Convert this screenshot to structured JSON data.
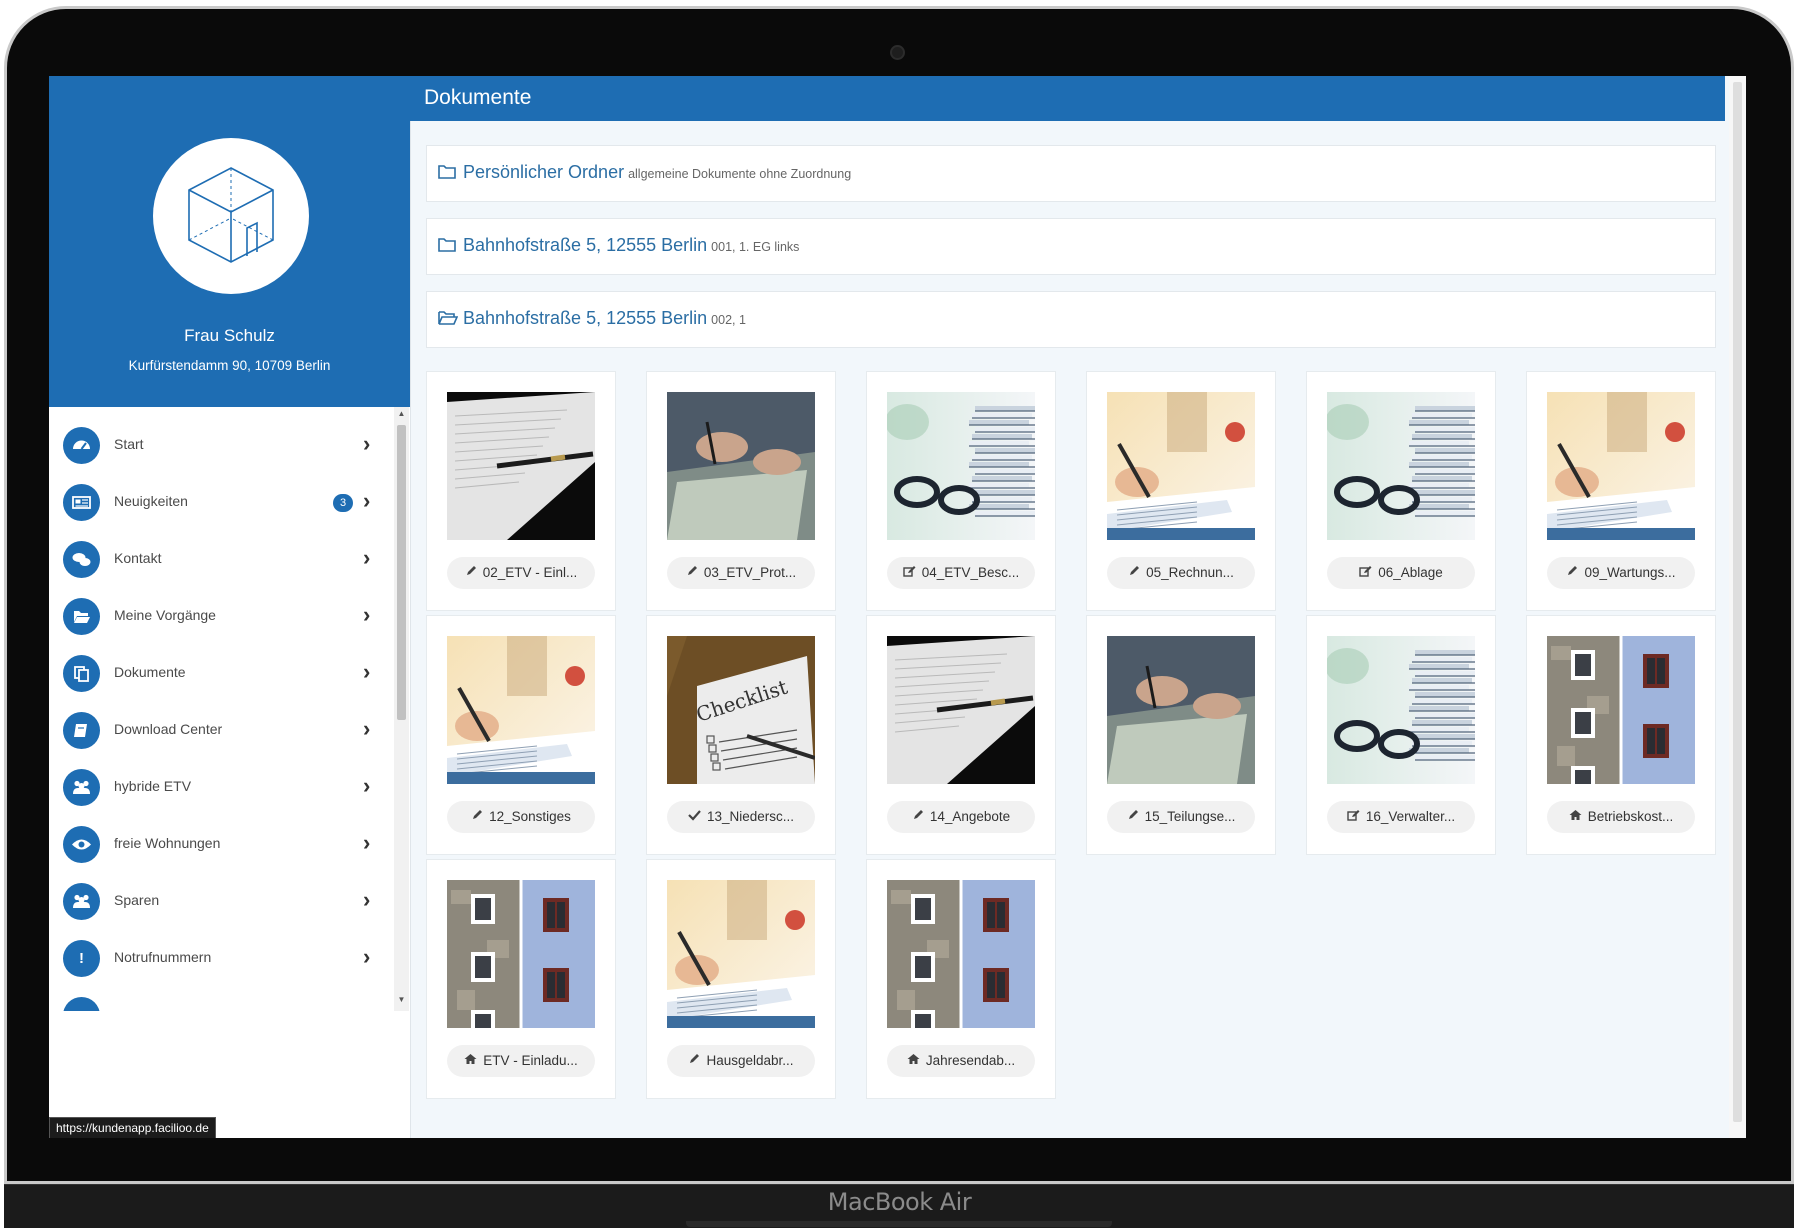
{
  "device": {
    "brand": "MacBook Air"
  },
  "header": {
    "title": "Dokumente"
  },
  "profile": {
    "name": "Frau Schulz",
    "address": "Kurfürstendamm 90, 10709 Berlin"
  },
  "sidebar": {
    "items": [
      {
        "label": "Start",
        "icon": "dashboard-icon"
      },
      {
        "label": "Neuigkeiten",
        "icon": "newspaper-icon",
        "badge": "3"
      },
      {
        "label": "Kontakt",
        "icon": "chat-icon"
      },
      {
        "label": "Meine Vorgänge",
        "icon": "folder-open-icon"
      },
      {
        "label": "Dokumente",
        "icon": "documents-icon"
      },
      {
        "label": "Download Center",
        "icon": "book-icon"
      },
      {
        "label": "hybride ETV",
        "icon": "users-icon"
      },
      {
        "label": "freie Wohnungen",
        "icon": "eye-icon"
      },
      {
        "label": "Sparen",
        "icon": "users-icon"
      },
      {
        "label": "Notrufnummern",
        "icon": "exclamation-icon"
      }
    ]
  },
  "status_url": "https://kundenapp.facilioo.de",
  "folders": [
    {
      "title": "Persönlicher Ordner",
      "subtitle": "allgemeine Dokumente ohne Zuordnung",
      "icon": "folder-icon"
    },
    {
      "title": "Bahnhofstraße 5, 12555 Berlin",
      "subtitle": "001, 1. EG links",
      "icon": "folder-icon"
    },
    {
      "title": "Bahnhofstraße 5, 12555 Berlin",
      "subtitle": "002, 1",
      "icon": "folder-open-icon"
    }
  ],
  "documents": [
    {
      "label": "02_ETV - Einl...",
      "icon": "pencil-icon",
      "image": "paper-pen"
    },
    {
      "label": "03_ETV_Prot...",
      "icon": "pencil-icon",
      "image": "hands-writing"
    },
    {
      "label": "04_ETV_Besc...",
      "icon": "edit-icon",
      "image": "stack-glasses"
    },
    {
      "label": "05_Rechnun...",
      "icon": "pencil-icon",
      "image": "signing"
    },
    {
      "label": "06_Ablage",
      "icon": "edit-icon",
      "image": "stack-glasses"
    },
    {
      "label": "09_Wartungs...",
      "icon": "pencil-icon",
      "image": "signing"
    },
    {
      "label": "12_Sonstiges",
      "icon": "pencil-icon",
      "image": "signing"
    },
    {
      "label": "13_Niedersc...",
      "icon": "check-icon",
      "image": "checklist"
    },
    {
      "label": "14_Angebote",
      "icon": "pencil-icon",
      "image": "paper-pen"
    },
    {
      "label": "15_Teilungse...",
      "icon": "pencil-icon",
      "image": "hands-writing"
    },
    {
      "label": "16_Verwalter...",
      "icon": "edit-icon",
      "image": "stack-glasses"
    },
    {
      "label": "Betriebskost...",
      "icon": "home-icon",
      "image": "facade"
    },
    {
      "label": "ETV - Einladu...",
      "icon": "home-icon",
      "image": "facade"
    },
    {
      "label": "Hausgeldabr...",
      "icon": "pencil-icon",
      "image": "signing"
    },
    {
      "label": "Jahresendab...",
      "icon": "home-icon",
      "image": "facade"
    }
  ],
  "checklist_text": "Checklist",
  "colors": {
    "primary": "#1e6db3",
    "link": "#2b6ea4",
    "background": "#f2f7fb"
  }
}
